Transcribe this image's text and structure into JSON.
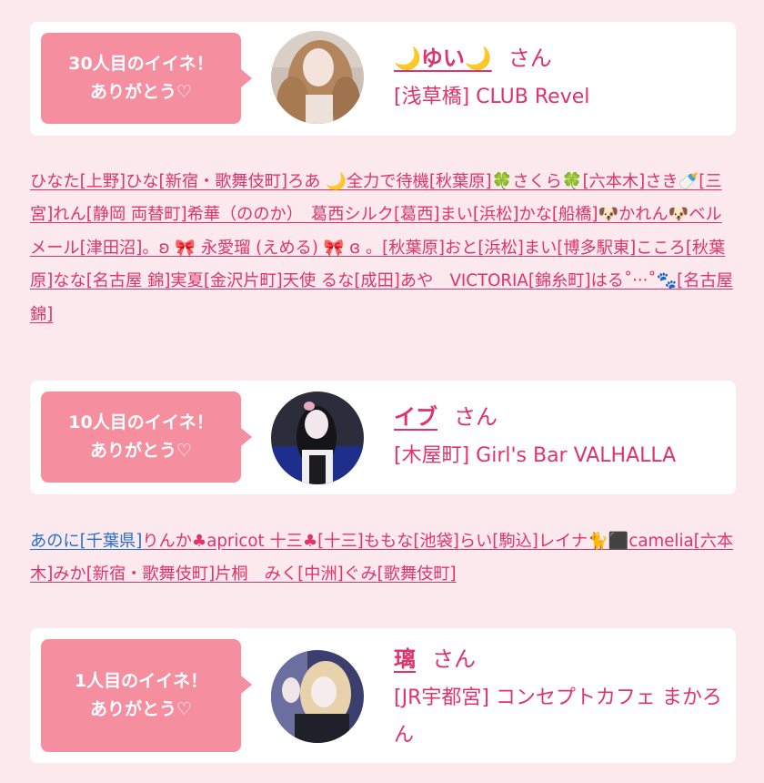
{
  "cards": [
    {
      "badge_line1": "30人目のイイネ！",
      "badge_line2": "ありがとう♡",
      "name": "🌙ゆい🌙",
      "honorific": "さん",
      "shop": "[浅草橋] CLUB Revel"
    },
    {
      "badge_line1": "10人目のイイネ！",
      "badge_line2": "ありがとう♡",
      "name": "イブ",
      "honorific": "さん",
      "shop": "[木屋町] Girl's Bar VALHALLA"
    },
    {
      "badge_line1": "1人目のイイネ！",
      "badge_line2": "ありがとう♡",
      "name": "璃",
      "honorific": "さん",
      "shop": "[JR宇都宮] コンセプトカフェ まかろん"
    }
  ],
  "list1": [
    "ひなた",
    "[上野]",
    "ひな",
    "[新宿・歌舞伎町]",
    "ろあ 🌙全力で待機",
    "[秋葉原]",
    "🍀さくら🍀",
    "[六本木]",
    "さき🍼",
    "[三宮]",
    "れん",
    "[静岡 両替町]",
    "希華（ののか）　葛西シルク",
    "[葛西]",
    "まい",
    "[浜松]",
    "かな",
    "[船橋]",
    "🐶かれん🐶ベルメール",
    "[津田沼]",
    "。ʚ 🎀 永愛瑠 (えめる) 🎀 ɞ 。",
    "[秋葉原]",
    "おと",
    "[浜松]",
    "まい",
    "[博多駅東]",
    "こころ",
    "[秋葉原]",
    "なな",
    "[名古屋 錦]",
    "実夏",
    "[金沢片町]",
    "天使 るな",
    "[成田]",
    "あや　VICTORIA",
    "[錦糸町]",
    "はる˚‧··˚🐾",
    "[名古屋 錦]"
  ],
  "list2": [
    "あのに",
    "[千葉県]",
    "りんか♣apricot 十三♣",
    "[十三]",
    "ももな",
    "[池袋]",
    "らい",
    "[駒込]",
    "レイナ🐈⬛camelia",
    "[六本木]",
    "みか",
    "[新宿・歌舞伎町]",
    "片桐　みく",
    "[中洲]",
    "ぐみ",
    "[歌舞伎町]"
  ],
  "colors": {
    "background": "#fbe9ee",
    "accent": "#e0336b",
    "badge": "#f58fa0",
    "visited_link": "#2770c9"
  },
  "icons": [
    "moon-icon",
    "clover-icon",
    "baby-bottle-icon",
    "dog-icon",
    "ribbon-icon",
    "paw-icon",
    "club-icon",
    "black-cat-icon"
  ]
}
